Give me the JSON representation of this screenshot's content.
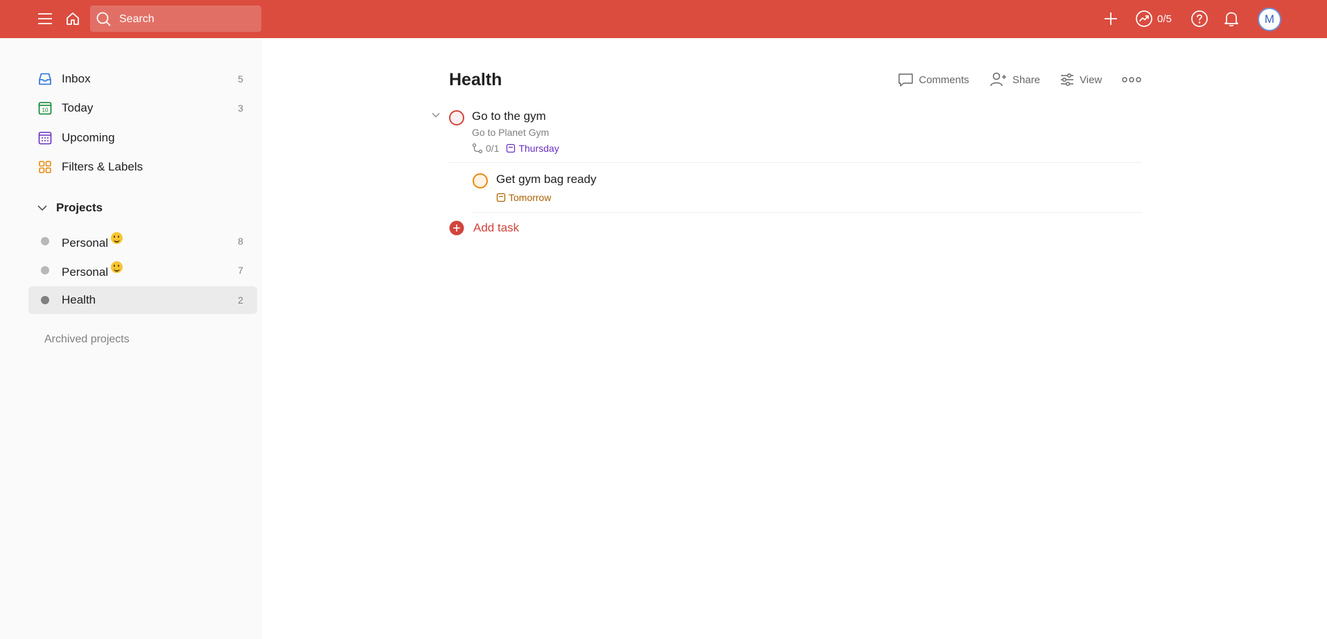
{
  "topbar": {
    "search_placeholder": "Search",
    "karma": "0/5",
    "avatar_initial": "M"
  },
  "sidebar": {
    "nav": [
      {
        "label": "Inbox",
        "count": "5",
        "icon": "inbox-icon",
        "color": "#246fe0"
      },
      {
        "label": "Today",
        "count": "3",
        "icon": "calendar-today-icon",
        "color": "#058527",
        "date": "10"
      },
      {
        "label": "Upcoming",
        "count": "",
        "icon": "calendar-upcoming-icon",
        "color": "#692fc2"
      },
      {
        "label": "Filters & Labels",
        "count": "",
        "icon": "filters-icon",
        "color": "#eb8909"
      }
    ],
    "projects_heading": "Projects",
    "projects": [
      {
        "label": "Personal",
        "count": "8",
        "emoji": "slightly-smiling-face"
      },
      {
        "label": "Personal",
        "count": "7",
        "emoji": "slightly-smiling-face"
      },
      {
        "label": "Health",
        "count": "2",
        "active": true
      }
    ],
    "archived_label": "Archived projects"
  },
  "main": {
    "title": "Health",
    "actions": {
      "comments": "Comments",
      "share": "Share",
      "view": "View"
    },
    "tasks": [
      {
        "title": "Go to the gym",
        "description": "Go to Planet Gym",
        "subtasks": "0/1",
        "due": "Thursday",
        "due_color": "#692fc2",
        "priority_color": "#d1453b"
      },
      {
        "title": "Get gym bag ready",
        "due": "Tomorrow",
        "due_color": "#ad6200",
        "priority_color": "#eb8909"
      }
    ],
    "add_task_label": "Add task"
  },
  "colors": {
    "brand": "#db4c3f",
    "sidebar_bg": "#fafafa",
    "active_item": "#ebebeb"
  }
}
